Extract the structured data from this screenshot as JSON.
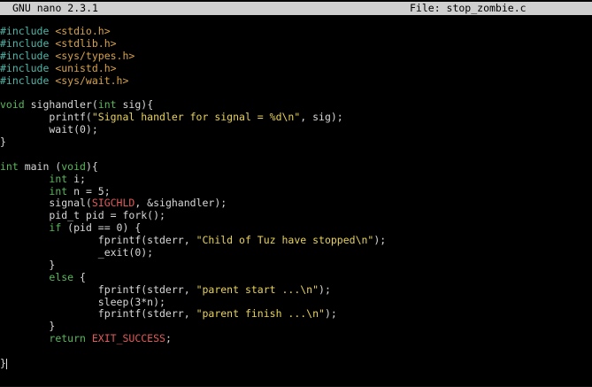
{
  "titlebar": {
    "app_version": "GNU nano 2.3.1",
    "file_label": "File: stop_zombie.c"
  },
  "colors": {
    "preprocessor": "#4fb6a8",
    "include_path": "#d7a24a",
    "keyword": "#58b85a",
    "string": "#e8d25a",
    "constant": "#e05a5a",
    "text": "#d8d8d8",
    "titlebar_bg": "#cfcfcf"
  },
  "editor": {
    "lines": [
      [
        {
          "t": "#include ",
          "c": "pre"
        },
        {
          "t": "<stdio.h>",
          "c": "inc"
        }
      ],
      [
        {
          "t": "#include ",
          "c": "pre"
        },
        {
          "t": "<stdlib.h>",
          "c": "inc"
        }
      ],
      [
        {
          "t": "#include ",
          "c": "pre"
        },
        {
          "t": "<sys/types.h>",
          "c": "inc"
        }
      ],
      [
        {
          "t": "#include ",
          "c": "pre"
        },
        {
          "t": "<unistd.h>",
          "c": "inc"
        }
      ],
      [
        {
          "t": "#include ",
          "c": "pre"
        },
        {
          "t": "<sys/wait.h>",
          "c": "inc"
        }
      ],
      [],
      [
        {
          "t": "void",
          "c": "kw"
        },
        {
          "t": " sighandler(",
          "c": "plain"
        },
        {
          "t": "int",
          "c": "kw"
        },
        {
          "t": " sig){",
          "c": "plain"
        }
      ],
      [
        {
          "t": "        printf(",
          "c": "plain"
        },
        {
          "t": "\"Signal handler for signal = %d\\n\"",
          "c": "str"
        },
        {
          "t": ", sig);",
          "c": "plain"
        }
      ],
      [
        {
          "t": "        wait(0);",
          "c": "plain"
        }
      ],
      [
        {
          "t": "}",
          "c": "plain"
        }
      ],
      [],
      [
        {
          "t": "int",
          "c": "kw"
        },
        {
          "t": " main (",
          "c": "plain"
        },
        {
          "t": "void",
          "c": "kw"
        },
        {
          "t": "){",
          "c": "plain"
        }
      ],
      [
        {
          "t": "        ",
          "c": "plain"
        },
        {
          "t": "int",
          "c": "kw"
        },
        {
          "t": " i;",
          "c": "plain"
        }
      ],
      [
        {
          "t": "        ",
          "c": "plain"
        },
        {
          "t": "int",
          "c": "kw"
        },
        {
          "t": " n = 5;",
          "c": "plain"
        }
      ],
      [
        {
          "t": "        signal(",
          "c": "plain"
        },
        {
          "t": "SIGCHLD",
          "c": "const"
        },
        {
          "t": ", &sighandler);",
          "c": "plain"
        }
      ],
      [
        {
          "t": "        pid_t pid = fork();",
          "c": "plain"
        }
      ],
      [
        {
          "t": "        ",
          "c": "plain"
        },
        {
          "t": "if",
          "c": "kw"
        },
        {
          "t": " (pid == 0) {",
          "c": "plain"
        }
      ],
      [
        {
          "t": "                fprintf(stderr, ",
          "c": "plain"
        },
        {
          "t": "\"Child of Tuz have stopped\\n\"",
          "c": "str"
        },
        {
          "t": ");",
          "c": "plain"
        }
      ],
      [
        {
          "t": "                _exit(0);",
          "c": "plain"
        }
      ],
      [
        {
          "t": "        }",
          "c": "plain"
        }
      ],
      [
        {
          "t": "        ",
          "c": "plain"
        },
        {
          "t": "else",
          "c": "kw"
        },
        {
          "t": " {",
          "c": "plain"
        }
      ],
      [
        {
          "t": "                fprintf(stderr, ",
          "c": "plain"
        },
        {
          "t": "\"parent start ...\\n\"",
          "c": "str"
        },
        {
          "t": ");",
          "c": "plain"
        }
      ],
      [
        {
          "t": "                sleep(3*n);",
          "c": "plain"
        }
      ],
      [
        {
          "t": "                fprintf(stderr, ",
          "c": "plain"
        },
        {
          "t": "\"parent finish ...\\n\"",
          "c": "str"
        },
        {
          "t": ");",
          "c": "plain"
        }
      ],
      [
        {
          "t": "        }",
          "c": "plain"
        }
      ],
      [
        {
          "t": "        ",
          "c": "plain"
        },
        {
          "t": "return",
          "c": "kw"
        },
        {
          "t": " ",
          "c": "plain"
        },
        {
          "t": "EXIT_SUCCESS",
          "c": "const"
        },
        {
          "t": ";",
          "c": "plain"
        }
      ],
      [],
      [
        {
          "t": "}",
          "c": "plain"
        }
      ]
    ],
    "cursor_line": 27
  }
}
